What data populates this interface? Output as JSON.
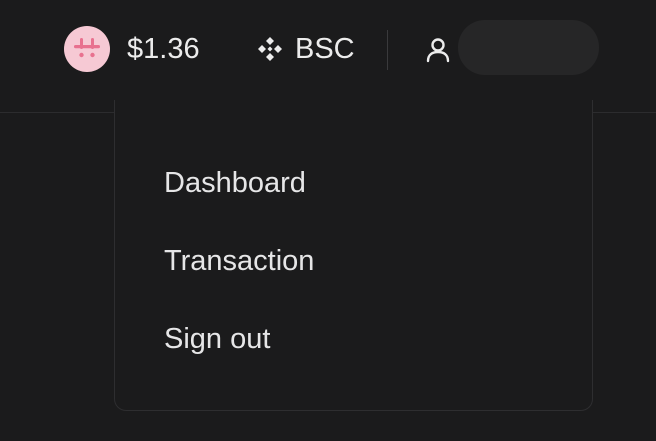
{
  "header": {
    "token_icon": "hashflow-token-icon",
    "price": "$1.36",
    "network": {
      "icon": "bnb-chain-icon",
      "label": "BSC"
    },
    "user_icon": "user-icon",
    "account_label": ""
  },
  "dropdown": {
    "items": [
      {
        "label": "Dashboard"
      },
      {
        "label": "Transaction"
      },
      {
        "label": "Sign out"
      }
    ]
  },
  "colors": {
    "background": "#1b1b1c",
    "token_icon_bg": "#f6c9d4",
    "token_icon_fg": "#e8718f",
    "text": "#e9e9ea",
    "pill": "#262627"
  }
}
